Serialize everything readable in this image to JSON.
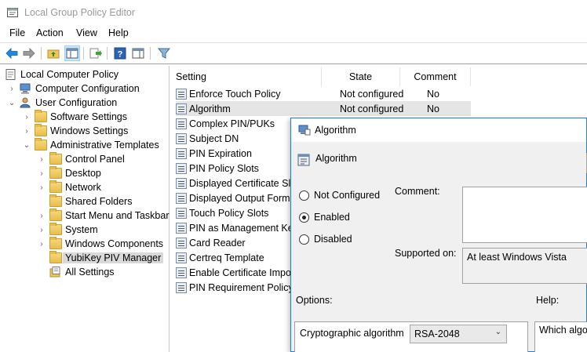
{
  "window": {
    "title": "Local Group Policy Editor"
  },
  "menu": [
    "File",
    "Action",
    "View",
    "Help"
  ],
  "toolbar": {
    "icons": [
      "back-icon",
      "forward-icon",
      "up-folder-icon",
      "show-hide-tree-icon",
      "export-list-icon",
      "help-icon",
      "show-hide-action-pane-icon",
      "filter-icon"
    ]
  },
  "tree": {
    "root": "Local Computer Policy",
    "computer_config": "Computer Configuration",
    "user_config": "User Configuration",
    "software_settings": "Software Settings",
    "windows_settings": "Windows Settings",
    "admin_templates": "Administrative Templates",
    "control_panel": "Control Panel",
    "desktop": "Desktop",
    "network": "Network",
    "shared_folders": "Shared Folders",
    "start_menu": "Start Menu and Taskbar",
    "system": "System",
    "windows_components": "Windows Components",
    "yubikey": "YubiKey PIV Manager",
    "all_settings": "All Settings"
  },
  "list": {
    "headers": {
      "setting": "Setting",
      "state": "State",
      "comment": "Comment"
    },
    "rows": [
      {
        "setting": "Enforce Touch Policy",
        "state": "Not configured",
        "comment": "No"
      },
      {
        "setting": "Algorithm",
        "state": "Not configured",
        "comment": "No"
      },
      {
        "setting": "Complex PIN/PUKs"
      },
      {
        "setting": "Subject DN"
      },
      {
        "setting": "PIN Expiration"
      },
      {
        "setting": "PIN Policy Slots"
      },
      {
        "setting": "Displayed Certificate Slots"
      },
      {
        "setting": "Displayed Output Format"
      },
      {
        "setting": "Touch Policy Slots"
      },
      {
        "setting": "PIN as Management Key"
      },
      {
        "setting": "Card Reader"
      },
      {
        "setting": "Certreq Template"
      },
      {
        "setting": "Enable Certificate Import"
      },
      {
        "setting": "PIN Requirement Policy"
      }
    ]
  },
  "dialog": {
    "title": "Algorithm",
    "policy_name": "Algorithm",
    "radio_not_configured": "Not Configured",
    "radio_enabled": "Enabled",
    "radio_disabled": "Disabled",
    "selected_radio": "Enabled",
    "comment_label": "Comment:",
    "comment_value": "",
    "supported_label": "Supported on:",
    "supported_value": "At least Windows Vista",
    "options_label": "Options:",
    "help_label": "Help:",
    "crypto_label": "Cryptographic algorithm",
    "crypto_value": "RSA-2048",
    "help_text": "Which algori"
  },
  "colors": {
    "accent_border": "#1e7fd6",
    "selection": "#d9d9d9"
  }
}
